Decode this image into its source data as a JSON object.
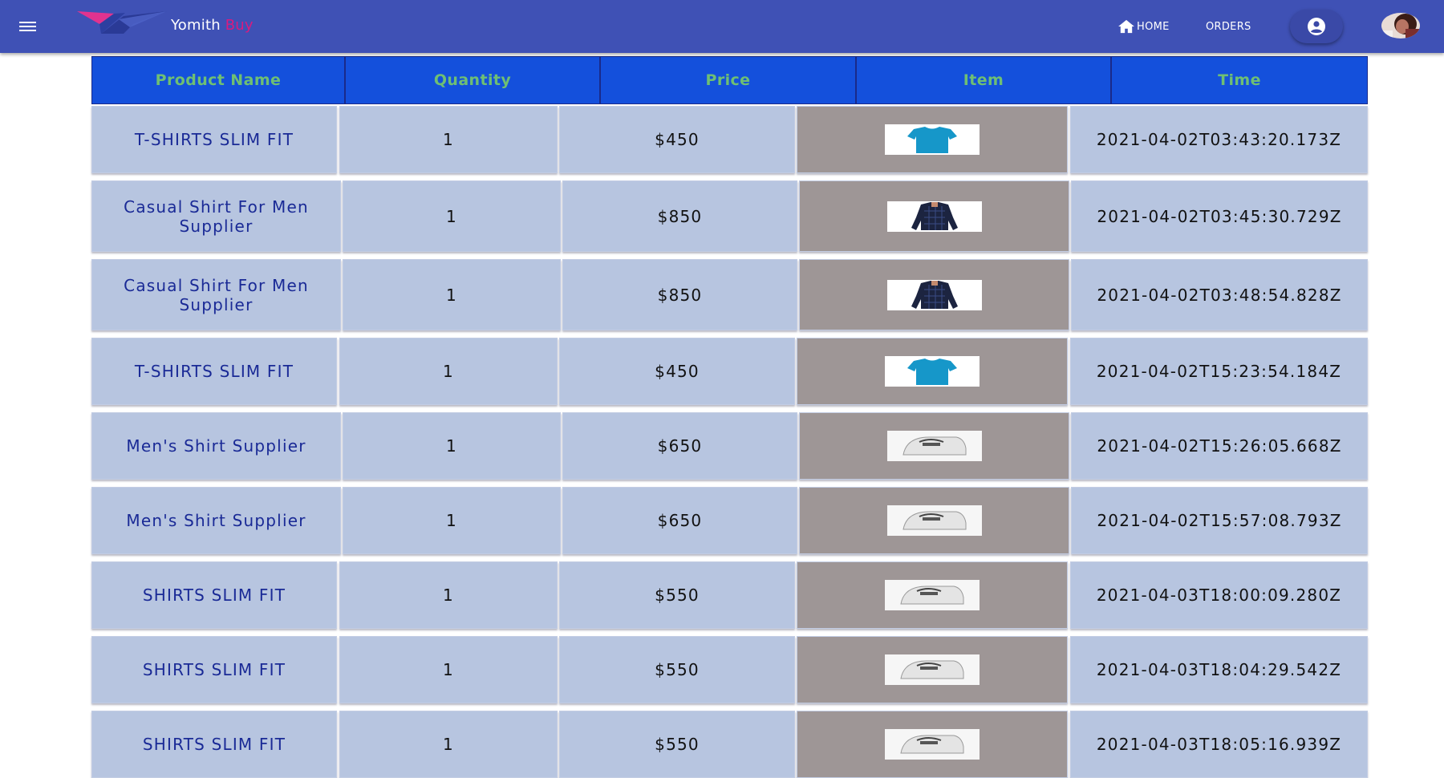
{
  "app": {
    "brand_name": "Yomith",
    "brand_accent": "Buy",
    "colors": {
      "appbar": "#3f51b5",
      "header_bg": "#1450dc",
      "header_text": "#6fbf73",
      "cell_bg": "#b7c5e0",
      "item_bg": "#9e9696",
      "name_text": "#1a2a96"
    }
  },
  "nav": {
    "home_label": "HOME",
    "orders_label": "ORDERS",
    "icons": {
      "menu": "menu-icon",
      "home": "home-icon",
      "account": "account-circle-icon"
    }
  },
  "orders": {
    "headers": [
      "Product Name",
      "Quantity",
      "Price",
      "Item",
      "Time"
    ],
    "rows": [
      {
        "name": "T-SHIRTS SLIM FIT",
        "qty": "1",
        "price": "$450",
        "thumb": "tshirt",
        "time": "2021-04-02T03:43:20.173Z"
      },
      {
        "name": "Casual Shirt For Men Supplier",
        "qty": "1",
        "price": "$850",
        "thumb": "casual",
        "time": "2021-04-02T03:45:30.729Z"
      },
      {
        "name": "Casual Shirt For Men Supplier",
        "qty": "1",
        "price": "$850",
        "thumb": "casual",
        "time": "2021-04-02T03:48:54.828Z"
      },
      {
        "name": "T-SHIRTS SLIM FIT",
        "qty": "1",
        "price": "$450",
        "thumb": "tshirt",
        "time": "2021-04-02T15:23:54.184Z"
      },
      {
        "name": "Men's Shirt Supplier",
        "qty": "1",
        "price": "$650",
        "thumb": "folded",
        "time": "2021-04-02T15:26:05.668Z"
      },
      {
        "name": "Men's Shirt Supplier",
        "qty": "1",
        "price": "$650",
        "thumb": "folded",
        "time": "2021-04-02T15:57:08.793Z"
      },
      {
        "name": "SHIRTS SLIM FIT",
        "qty": "1",
        "price": "$550",
        "thumb": "folded",
        "time": "2021-04-03T18:00:09.280Z"
      },
      {
        "name": "SHIRTS SLIM FIT",
        "qty": "1",
        "price": "$550",
        "thumb": "folded",
        "time": "2021-04-03T18:04:29.542Z"
      },
      {
        "name": "SHIRTS SLIM FIT",
        "qty": "1",
        "price": "$550",
        "thumb": "folded",
        "time": "2021-04-03T18:05:16.939Z"
      }
    ]
  }
}
